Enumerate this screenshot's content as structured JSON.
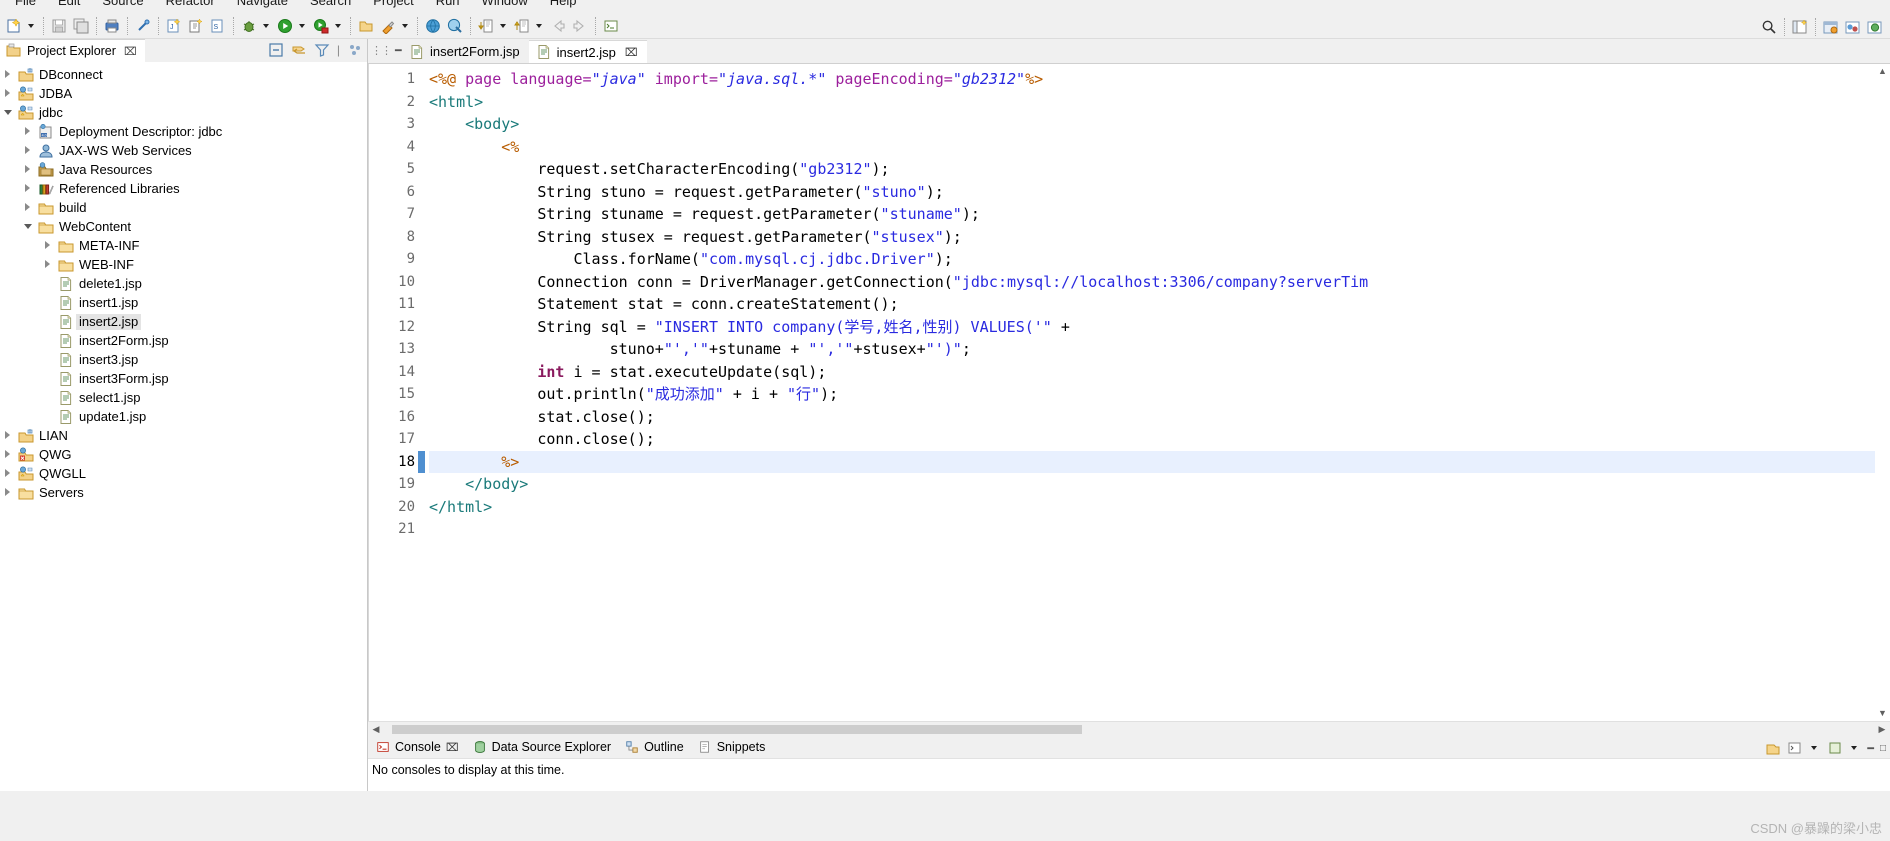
{
  "menu": {
    "items": [
      "File",
      "Edit",
      "Source",
      "Refactor",
      "Navigate",
      "Search",
      "Project",
      "Run",
      "Window",
      "Help"
    ]
  },
  "toolbar": {
    "icons": [
      "new-wizard-icon",
      "new-dropdown-arrow",
      "save-icon",
      "save-all-icon",
      "print-icon",
      "link-icon",
      "new-jsp-icon",
      "new-servlet-icon",
      "new-xml-icon",
      "debug-icon",
      "debug-dropdown-arrow",
      "run-icon",
      "run-dropdown-arrow",
      "run-server-icon",
      "server-dropdown-arrow",
      "open-type-icon",
      "external-tools-icon",
      "external-dropdown-arrow",
      "web-browser-icon",
      "web-deploy-icon",
      "next-annotation-icon",
      "next-dropdown-arrow",
      "prev-annotation-icon",
      "prev-dropdown-arrow",
      "back-icon",
      "forward-icon",
      "terminal-icon"
    ],
    "right_icons": [
      "search-icon",
      "perspective-open-icon",
      "perspective-java-ee-icon",
      "perspective-java-icon",
      "perspective-web-icon"
    ]
  },
  "project_explorer": {
    "title": "Project Explorer",
    "close_glyph": "⌧",
    "view_icons": [
      "collapse-all-icon",
      "link-with-editor-icon",
      "view-menu-filter-icon",
      "view-menu-icon"
    ],
    "tree": [
      {
        "label": "DBconnect",
        "indent": 0,
        "twisty": "collapsed",
        "icon": "project-closed-icon",
        "selected": false
      },
      {
        "label": "JDBA",
        "indent": 0,
        "twisty": "collapsed",
        "icon": "project-web-icon",
        "selected": false
      },
      {
        "label": "jdbc",
        "indent": 0,
        "twisty": "expanded",
        "icon": "project-web-icon",
        "selected": false
      },
      {
        "label": "Deployment Descriptor: jdbc",
        "indent": 1,
        "twisty": "collapsed",
        "icon": "deployment-desc-icon",
        "selected": false
      },
      {
        "label": "JAX-WS Web Services",
        "indent": 1,
        "twisty": "collapsed",
        "icon": "jaxws-icon",
        "selected": false
      },
      {
        "label": "Java Resources",
        "indent": 1,
        "twisty": "collapsed",
        "icon": "java-resources-icon",
        "selected": false
      },
      {
        "label": "Referenced Libraries",
        "indent": 1,
        "twisty": "collapsed",
        "icon": "libraries-icon",
        "selected": false
      },
      {
        "label": "build",
        "indent": 1,
        "twisty": "collapsed",
        "icon": "folder-icon",
        "selected": false
      },
      {
        "label": "WebContent",
        "indent": 1,
        "twisty": "expanded",
        "icon": "folder-icon",
        "selected": false
      },
      {
        "label": "META-INF",
        "indent": 2,
        "twisty": "collapsed",
        "icon": "folder-icon",
        "selected": false
      },
      {
        "label": "WEB-INF",
        "indent": 2,
        "twisty": "collapsed",
        "icon": "folder-icon",
        "selected": false
      },
      {
        "label": "delete1.jsp",
        "indent": 2,
        "twisty": "none",
        "icon": "jsp-file-icon",
        "selected": false
      },
      {
        "label": "insert1.jsp",
        "indent": 2,
        "twisty": "none",
        "icon": "jsp-file-icon",
        "selected": false
      },
      {
        "label": "insert2.jsp",
        "indent": 2,
        "twisty": "none",
        "icon": "jsp-file-icon",
        "selected": true
      },
      {
        "label": "insert2Form.jsp",
        "indent": 2,
        "twisty": "none",
        "icon": "jsp-file-icon",
        "selected": false
      },
      {
        "label": "insert3.jsp",
        "indent": 2,
        "twisty": "none",
        "icon": "jsp-file-icon",
        "selected": false
      },
      {
        "label": "insert3Form.jsp",
        "indent": 2,
        "twisty": "none",
        "icon": "jsp-file-icon",
        "selected": false
      },
      {
        "label": "select1.jsp",
        "indent": 2,
        "twisty": "none",
        "icon": "jsp-file-icon",
        "selected": false
      },
      {
        "label": "update1.jsp",
        "indent": 2,
        "twisty": "none",
        "icon": "jsp-file-icon",
        "selected": false
      },
      {
        "label": "LIAN",
        "indent": 0,
        "twisty": "collapsed",
        "icon": "project-closed-icon",
        "selected": false
      },
      {
        "label": "QWG",
        "indent": 0,
        "twisty": "collapsed",
        "icon": "project-error-icon",
        "selected": false
      },
      {
        "label": "QWGLL",
        "indent": 0,
        "twisty": "collapsed",
        "icon": "project-web-icon",
        "selected": false
      },
      {
        "label": "Servers",
        "indent": 0,
        "twisty": "collapsed",
        "icon": "folder-icon",
        "selected": false
      }
    ]
  },
  "editor": {
    "left_controls": [
      "editor-menu-icon",
      "minimize-icon",
      "maximize-icon"
    ],
    "tabs": [
      {
        "label": "insert2Form.jsp",
        "active": false,
        "close": ""
      },
      {
        "label": "insert2.jsp",
        "active": true,
        "close": "⌧"
      }
    ],
    "current_line": 18,
    "line_count": 21,
    "lines": [
      {
        "n": 1,
        "fold": "",
        "segments": [
          {
            "t": "<%@ ",
            "c": "k-jsp"
          },
          {
            "t": "page ",
            "c": "k-attr"
          },
          {
            "t": "language=",
            "c": "k-attr"
          },
          {
            "t": "\"java\"",
            "c": "k-str"
          },
          {
            "t": " ",
            "c": "k-plain"
          },
          {
            "t": "import=",
            "c": "k-attr"
          },
          {
            "t": "\"java.sql.*\"",
            "c": "k-str"
          },
          {
            "t": " ",
            "c": "k-plain"
          },
          {
            "t": "pageEncoding=",
            "c": "k-attr"
          },
          {
            "t": "\"gb2312\"",
            "c": "k-str"
          },
          {
            "t": "%>",
            "c": "k-jsp"
          }
        ]
      },
      {
        "n": 2,
        "fold": "⊖",
        "segments": [
          {
            "t": "<html>",
            "c": "k-tag"
          }
        ]
      },
      {
        "n": 3,
        "fold": "⊖",
        "segments": [
          {
            "t": "    <body>",
            "c": "k-tag"
          }
        ]
      },
      {
        "n": 4,
        "fold": "⊖",
        "segments": [
          {
            "t": "        <%",
            "c": "k-jsp"
          }
        ]
      },
      {
        "n": 5,
        "fold": "",
        "segments": [
          {
            "t": "            request.setCharacterEncoding(",
            "c": "k-plain"
          },
          {
            "t": "\"gb2312\"",
            "c": "k-str2"
          },
          {
            "t": ");",
            "c": "k-plain"
          }
        ]
      },
      {
        "n": 6,
        "fold": "",
        "segments": [
          {
            "t": "            String stuno = request.getParameter(",
            "c": "k-plain"
          },
          {
            "t": "\"stuno\"",
            "c": "k-str2"
          },
          {
            "t": ");",
            "c": "k-plain"
          }
        ]
      },
      {
        "n": 7,
        "fold": "",
        "segments": [
          {
            "t": "            String stuname = request.getParameter(",
            "c": "k-plain"
          },
          {
            "t": "\"stuname\"",
            "c": "k-str2"
          },
          {
            "t": ");",
            "c": "k-plain"
          }
        ]
      },
      {
        "n": 8,
        "fold": "",
        "segments": [
          {
            "t": "            String stusex = request.getParameter(",
            "c": "k-plain"
          },
          {
            "t": "\"stusex\"",
            "c": "k-str2"
          },
          {
            "t": ");",
            "c": "k-plain"
          }
        ]
      },
      {
        "n": 9,
        "fold": "",
        "segments": [
          {
            "t": "                Class.forName(",
            "c": "k-plain"
          },
          {
            "t": "\"com.mysql.cj.jdbc.Driver\"",
            "c": "k-str2"
          },
          {
            "t": ");",
            "c": "k-plain"
          }
        ]
      },
      {
        "n": 10,
        "fold": "",
        "segments": [
          {
            "t": "            Connection conn = DriverManager.getConnection(",
            "c": "k-plain"
          },
          {
            "t": "\"jdbc:mysql://localhost:3306/company?serverTim",
            "c": "k-str2"
          }
        ]
      },
      {
        "n": 11,
        "fold": "",
        "segments": [
          {
            "t": "            Statement stat = conn.createStatement();",
            "c": "k-plain"
          }
        ]
      },
      {
        "n": 12,
        "fold": "",
        "segments": [
          {
            "t": "            String sql = ",
            "c": "k-plain"
          },
          {
            "t": "\"INSERT INTO company(学号,姓名,性别) VALUES('\"",
            "c": "k-str2"
          },
          {
            "t": " +",
            "c": "k-plain"
          }
        ]
      },
      {
        "n": 13,
        "fold": "",
        "segments": [
          {
            "t": "                    stuno+",
            "c": "k-plain"
          },
          {
            "t": "\"','\"",
            "c": "k-str2"
          },
          {
            "t": "+stuname + ",
            "c": "k-plain"
          },
          {
            "t": "\"','\"",
            "c": "k-str2"
          },
          {
            "t": "+stusex+",
            "c": "k-plain"
          },
          {
            "t": "\"')\"",
            "c": "k-str2"
          },
          {
            "t": ";",
            "c": "k-plain"
          }
        ]
      },
      {
        "n": 14,
        "fold": "",
        "segments": [
          {
            "t": "            ",
            "c": "k-plain"
          },
          {
            "t": "int",
            "c": "k-kw"
          },
          {
            "t": " i = stat.executeUpdate(sql);",
            "c": "k-plain"
          }
        ]
      },
      {
        "n": 15,
        "fold": "",
        "segments": [
          {
            "t": "            out.println(",
            "c": "k-plain"
          },
          {
            "t": "\"成功添加\"",
            "c": "k-str2"
          },
          {
            "t": " + i + ",
            "c": "k-plain"
          },
          {
            "t": "\"行\"",
            "c": "k-str2"
          },
          {
            "t": ");",
            "c": "k-plain"
          }
        ]
      },
      {
        "n": 16,
        "fold": "",
        "segments": [
          {
            "t": "            stat.close();",
            "c": "k-plain"
          }
        ]
      },
      {
        "n": 17,
        "fold": "",
        "segments": [
          {
            "t": "            conn.close();",
            "c": "k-plain"
          }
        ]
      },
      {
        "n": 18,
        "fold": "",
        "segments": [
          {
            "t": "        %>",
            "c": "k-jsp"
          }
        ]
      },
      {
        "n": 19,
        "fold": "",
        "segments": [
          {
            "t": "    </body>",
            "c": "k-tag"
          }
        ]
      },
      {
        "n": 20,
        "fold": "",
        "segments": [
          {
            "t": "</html>",
            "c": "k-tag"
          }
        ]
      },
      {
        "n": 21,
        "fold": "",
        "segments": [
          {
            "t": "",
            "c": "k-plain"
          }
        ]
      }
    ]
  },
  "console": {
    "tabs": [
      {
        "label": "Console",
        "icon": "console-icon",
        "active": true,
        "close": "⌧"
      },
      {
        "label": "Data Source Explorer",
        "icon": "datasource-icon",
        "active": false,
        "close": ""
      },
      {
        "label": "Outline",
        "icon": "outline-icon",
        "active": false,
        "close": ""
      },
      {
        "label": "Snippets",
        "icon": "snippets-icon",
        "active": false,
        "close": ""
      }
    ],
    "tools": [
      "open-console-icon",
      "new-console-icon",
      "console-dropdown-arrow",
      "pin-console-icon",
      "display-dropdown-arrow",
      "minimize-icon",
      "maximize-icon"
    ],
    "message": "No consoles to display at this time."
  },
  "watermark": "CSDN @暴躁的梁小忠",
  "colors": {
    "selection_blue": "#e8f0fe",
    "current_line_marker": "#4f8fd0",
    "string": "#2a2ae0",
    "tag": "#1a7a7a",
    "jsp_delim": "#b85c00",
    "attribute": "#9c1f9c",
    "keyword": "#8a1a5e"
  }
}
